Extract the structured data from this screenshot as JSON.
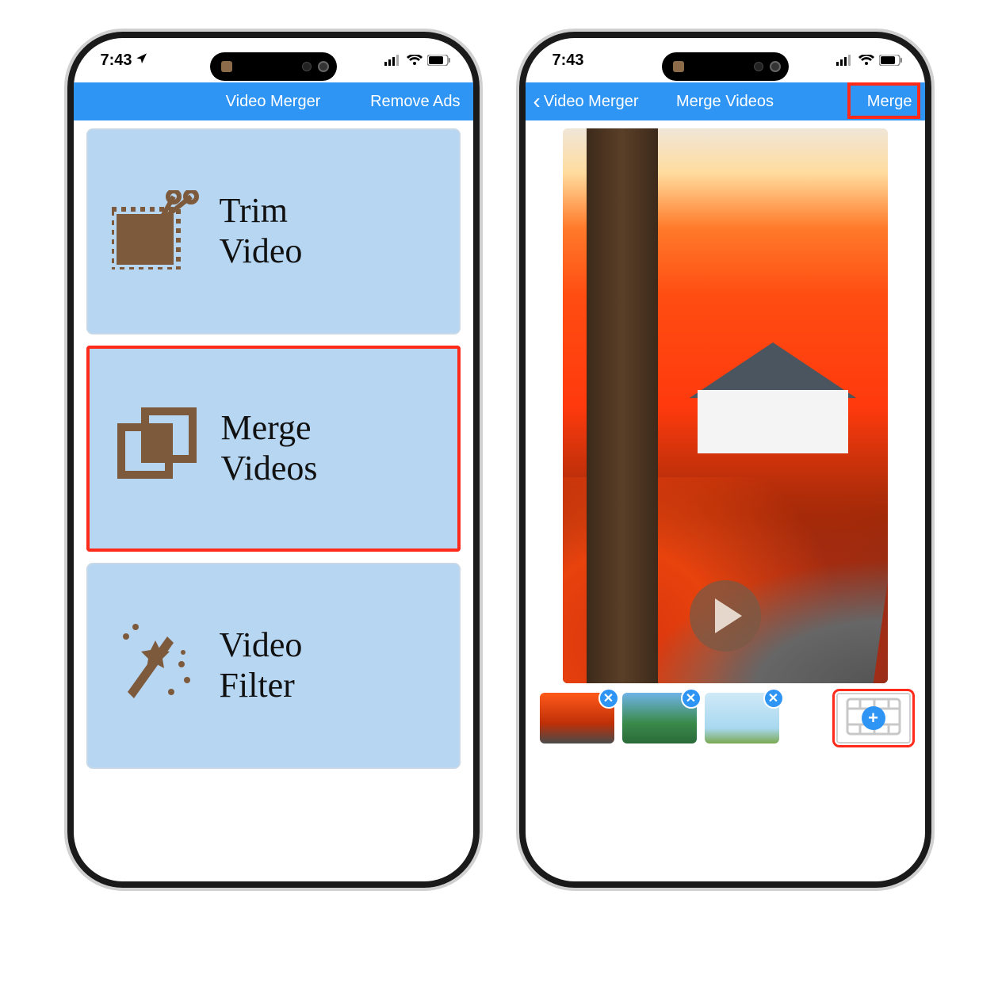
{
  "status": {
    "time": "7:43"
  },
  "screen1": {
    "nav": {
      "title": "Video Merger",
      "right": "Remove Ads"
    },
    "tiles": [
      {
        "label": "Trim\nVideo"
      },
      {
        "label": "Merge\nVideos"
      },
      {
        "label": "Video\nFilter"
      }
    ]
  },
  "screen2": {
    "nav": {
      "back": "Video Merger",
      "title": "Merge Videos",
      "right": "Merge"
    },
    "thumbs": [
      "clip-1",
      "clip-2",
      "clip-3"
    ],
    "add_label": "+"
  },
  "highlight_color": "#ff2a1a"
}
